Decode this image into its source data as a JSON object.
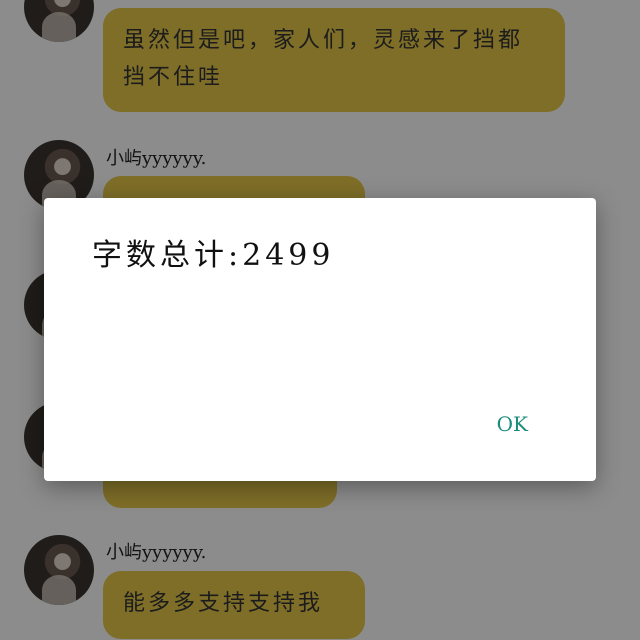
{
  "chat": {
    "messages": [
      {
        "sender": "",
        "text": "虽然但是吧，家人们，灵感来了挡都挡不住哇"
      },
      {
        "sender": "小屿yyyyyy.",
        "text": ""
      },
      {
        "sender": "",
        "text": ""
      },
      {
        "sender": "",
        "text": ""
      },
      {
        "sender": "小屿yyyyyy.",
        "text": "能多多支持支持我"
      }
    ]
  },
  "dialog": {
    "message": "字数总计:2499",
    "ok_label": "OK"
  },
  "colors": {
    "bubble": "#e6c84a",
    "accent": "#1a8b7c"
  }
}
